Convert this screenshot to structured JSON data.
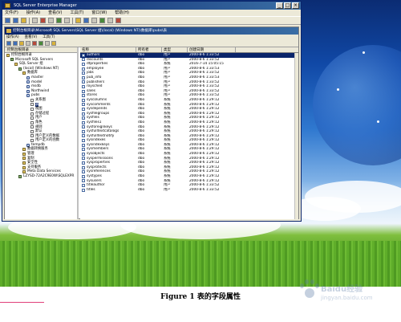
{
  "window": {
    "title": "SQL Server Enterprise Manager",
    "menu": [
      "文件(F)",
      "操作(A)",
      "查看(V)",
      "工具(T)",
      "窗口(W)",
      "帮助(H)"
    ],
    "controls": [
      "_",
      "□",
      "×"
    ]
  },
  "inner": {
    "title": "控制台根目录\\Microsoft SQL Servers\\SQL Server 组\\(local) (Windows NT)\\数据库\\pubs\\表",
    "menu": [
      "操作(A)",
      "查看(V)",
      "工具(T)"
    ]
  },
  "tree": {
    "header": "控制台根目录",
    "nodes": [
      {
        "label": "控制台根目录",
        "icon": "folder-icon",
        "indent": 0
      },
      {
        "label": "Microsoft SQL Servers",
        "icon": "server-group-icon",
        "indent": 1
      },
      {
        "label": "SQL Server 组",
        "icon": "folder-icon",
        "indent": 2
      },
      {
        "label": "(local) (Windows NT)",
        "icon": "server-icon",
        "indent": 3
      },
      {
        "label": "数据库",
        "icon": "folder-icon",
        "indent": 4
      },
      {
        "label": "master",
        "icon": "database-icon",
        "indent": 5
      },
      {
        "label": "model",
        "icon": "database-icon",
        "indent": 5
      },
      {
        "label": "msdb",
        "icon": "database-icon",
        "indent": 5
      },
      {
        "label": "Northwind",
        "icon": "database-icon",
        "indent": 5
      },
      {
        "label": "pubs",
        "icon": "database-icon",
        "indent": 5
      },
      {
        "label": "关系图",
        "icon": "diagram-icon",
        "indent": 6
      },
      {
        "label": "表",
        "icon": "table-icon",
        "indent": 6,
        "selected": true
      },
      {
        "label": "视图",
        "icon": "view-icon",
        "indent": 6
      },
      {
        "label": "存储过程",
        "icon": "procedure-icon",
        "indent": 6
      },
      {
        "label": "用户",
        "icon": "user-icon",
        "indent": 6
      },
      {
        "label": "角色",
        "icon": "role-icon",
        "indent": 6
      },
      {
        "label": "规则",
        "icon": "rule-icon",
        "indent": 6
      },
      {
        "label": "默认",
        "icon": "default-icon",
        "indent": 6
      },
      {
        "label": "用户定义的数据",
        "icon": "type-icon",
        "indent": 6
      },
      {
        "label": "用户定义的函数",
        "icon": "function-icon",
        "indent": 6
      },
      {
        "label": "tempdb",
        "icon": "database-icon",
        "indent": 5
      },
      {
        "label": "数据转换服务",
        "icon": "folder-icon",
        "indent": 4
      },
      {
        "label": "管理",
        "icon": "folder-icon",
        "indent": 4
      },
      {
        "label": "复制",
        "icon": "folder-icon",
        "indent": 4
      },
      {
        "label": "安全性",
        "icon": "folder-icon",
        "indent": 4
      },
      {
        "label": "支持服务",
        "icon": "folder-icon",
        "indent": 4
      },
      {
        "label": "Meta Data Services",
        "icon": "folder-icon",
        "indent": 4
      },
      {
        "label": "LZYSD-72A2C9E0W\\SQLEXPR",
        "icon": "server-icon",
        "indent": 3
      }
    ]
  },
  "list": {
    "columns": [
      "名称",
      "所有者",
      "类型",
      "创建日期"
    ],
    "rows": [
      [
        "authors",
        "dbo",
        "用户",
        "2000-8-6 1:33:52"
      ],
      [
        "discounts",
        "dbo",
        "用户",
        "2000-8-6 1:33:52"
      ],
      [
        "dtproperties",
        "dbo",
        "系统",
        "2016-7-14 15:05:15"
      ],
      [
        "employee",
        "dbo",
        "用户",
        "2000-8-6 1:33:53"
      ],
      [
        "jobs",
        "dbo",
        "用户",
        "2000-8-6 1:33:52"
      ],
      [
        "pub_info",
        "dbo",
        "用户",
        "2000-8-6 1:33:53"
      ],
      [
        "publishers",
        "dbo",
        "用户",
        "2000-8-6 1:33:52"
      ],
      [
        "roysched",
        "dbo",
        "用户",
        "2000-8-6 1:33:52"
      ],
      [
        "sales",
        "dbo",
        "用户",
        "2000-8-6 1:33:52"
      ],
      [
        "stores",
        "dbo",
        "用户",
        "2000-8-6 1:33:52"
      ],
      [
        "syscolumns",
        "dbo",
        "系统",
        "2000-8-6 1:29:12"
      ],
      [
        "syscomments",
        "dbo",
        "系统",
        "2000-8-6 1:29:12"
      ],
      [
        "sysdepends",
        "dbo",
        "系统",
        "2000-8-6 1:29:12"
      ],
      [
        "sysfilegroups",
        "dbo",
        "系统",
        "2000-8-6 1:29:12"
      ],
      [
        "sysfiles",
        "dbo",
        "系统",
        "2000-8-6 1:29:12"
      ],
      [
        "sysfiles1",
        "dbo",
        "系统",
        "2000-8-6 1:29:12"
      ],
      [
        "sysforeignkeys",
        "dbo",
        "系统",
        "2000-8-6 1:29:12"
      ],
      [
        "sysfulltextcatalogs",
        "dbo",
        "系统",
        "2000-8-6 1:29:12"
      ],
      [
        "sysfulltextnotify",
        "dbo",
        "系统",
        "2000-8-6 1:29:12"
      ],
      [
        "sysindexes",
        "dbo",
        "系统",
        "2000-8-6 1:29:12"
      ],
      [
        "sysindexkeys",
        "dbo",
        "系统",
        "2000-8-6 1:29:12"
      ],
      [
        "sysmembers",
        "dbo",
        "系统",
        "2000-8-6 1:29:12"
      ],
      [
        "sysobjects",
        "dbo",
        "系统",
        "2000-8-6 1:29:12"
      ],
      [
        "syspermissions",
        "dbo",
        "系统",
        "2000-8-6 1:29:12"
      ],
      [
        "sysproperties",
        "dbo",
        "系统",
        "2000-8-6 1:29:12"
      ],
      [
        "sysprotects",
        "dbo",
        "系统",
        "2000-8-6 1:29:12"
      ],
      [
        "sysreferences",
        "dbo",
        "系统",
        "2000-8-6 1:29:12"
      ],
      [
        "systypes",
        "dbo",
        "系统",
        "2000-8-6 1:29:12"
      ],
      [
        "sysusers",
        "dbo",
        "系统",
        "2000-8-6 1:29:12"
      ],
      [
        "titleauthor",
        "dbo",
        "用户",
        "2000-8-6 1:33:52"
      ],
      [
        "titles",
        "dbo",
        "用户",
        "2000-8-6 1:33:52"
      ]
    ]
  },
  "caption": "Figure 1  表的字段属性",
  "watermark": {
    "text": "Baidu经验",
    "url": "jingyan.baidu.com"
  },
  "colors": {
    "titlebar": "#0a246a",
    "selection": "#0a246a",
    "window": "#ece9d8"
  }
}
